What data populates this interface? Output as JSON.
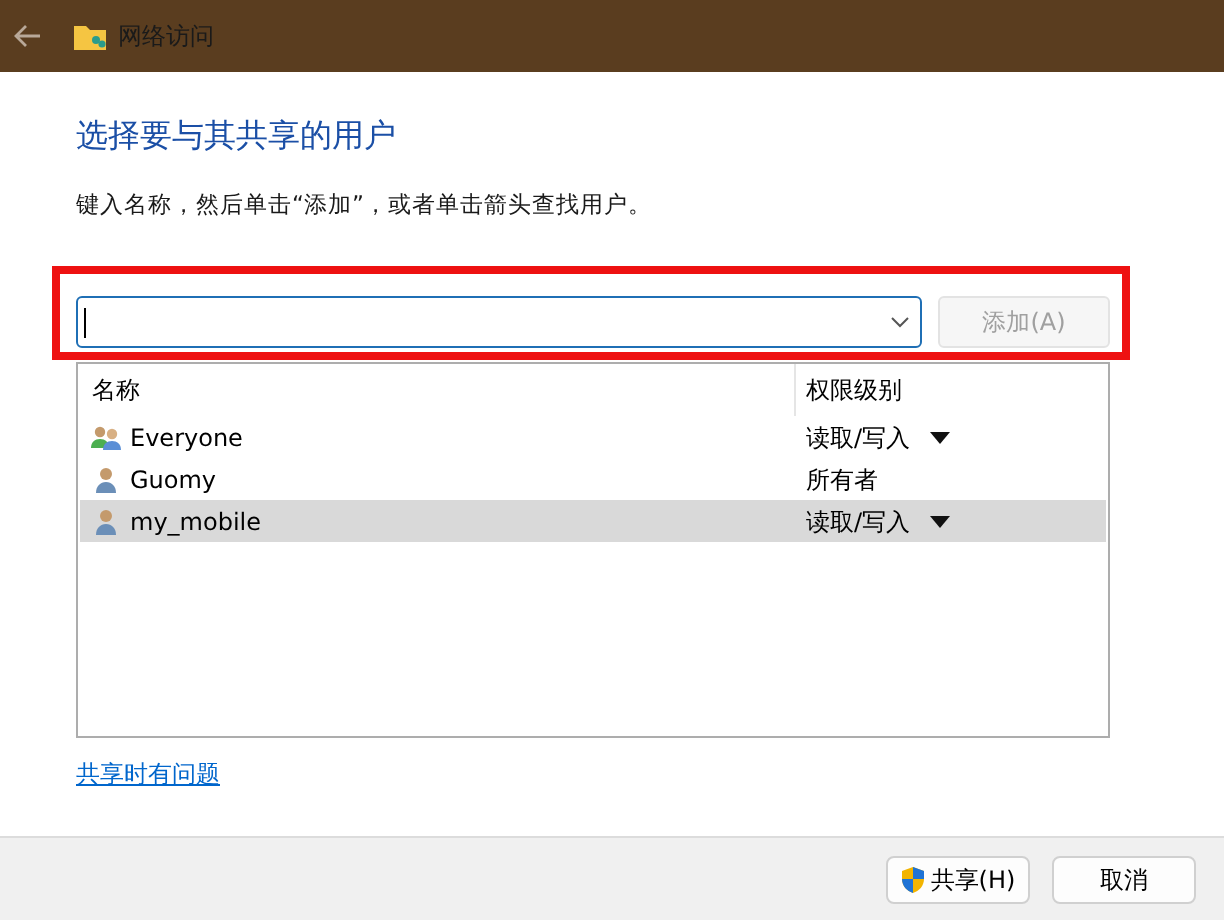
{
  "window": {
    "title": "网络访问"
  },
  "heading": "选择要与其共享的用户",
  "instruction": "键入名称，然后单击“添加”，或者单击箭头查找用户。",
  "add_row": {
    "highlighted": true,
    "add_button": {
      "label": "添加(A)",
      "disabled": true
    }
  },
  "table": {
    "columns": [
      "名称",
      "权限级别"
    ],
    "rows": [
      {
        "name": "Everyone",
        "kind": "group",
        "permission": "读取/写入",
        "has_dropdown": true,
        "selected": false
      },
      {
        "name": "Guomy",
        "kind": "user",
        "permission": "所有者",
        "has_dropdown": false,
        "selected": false
      },
      {
        "name": "my_mobile",
        "kind": "user",
        "permission": "读取/写入",
        "has_dropdown": true,
        "selected": true
      }
    ]
  },
  "help_link": "共享时有问题",
  "buttons": [
    {
      "label": "共享(H)",
      "shield": true
    },
    {
      "label": "取消",
      "shield": false
    }
  ]
}
